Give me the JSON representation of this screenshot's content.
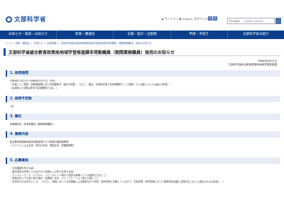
{
  "header": {
    "logo_text": "文部科学省",
    "sitemap": "▶ サイトマップ",
    "english": "▶ English",
    "font_size_label": "文字サイズの変更",
    "font_size_small": "小",
    "font_size_large": "大",
    "search_placeholder": "Custom Search",
    "search_logo": "Google"
  },
  "nav": [
    "お知らせ・報道・お知らせ",
    "政策・審議会",
    "白書・統計・出版物",
    "申請・手続き",
    "文部科学省の紹介"
  ],
  "breadcrumb": [
    "トップ",
    "政策・審議会",
    "お知らせ",
    "採用情報",
    "文部科学省総合教育政策局地域学習推進課非常勤職員（期間業務職員）採用のお知らせ"
  ],
  "title": "文部科学省総合教育政策局地域学習推進課非常勤職員（期間業務職員）採用のお知らせ",
  "date": "令和6年6月25日",
  "org": "文部科学省総合教育政策局地域学習推進課",
  "sections": [
    {
      "heading": "1. 採用期間",
      "lines": [
        "令和6年11月1日〜令和6年3月31日（予定）",
        "（年度ごとに契約。勤務実績等に応じ任用更新可（最大3年間）。ただし、国は、文部科学省で非常勤職員として勤務している者については最大3年間。）",
        "（採用後1ヵ月間は条件付採用期間となる。）"
      ]
    },
    {
      "heading": "2. 採用予定数",
      "lines": [
        "1名"
      ]
    },
    {
      "heading": "3. 職名",
      "lines": [
        "事務補佐員（非常勤職員（期間業務職員））"
      ]
    },
    {
      "heading": "4. 業務内容",
      "lines": [
        "総合教育政策局地域学習推進課で行う事務の補助業務等",
        "（パソコンによる文書・資料の作成、電話応対、書類整理等）"
      ]
    },
    {
      "heading": "5. 応募資格",
      "lines": [
        "・日本国籍を有する者",
        "・基本学校を卒業した又はそれと同等以上の学力を有する者",
        "・パソコン（ワード・エクセル、パワーポイント等の一般的な事務ソフトが使用できること）",
        "・素直を持って仕事に取り組み、協調性に富み、コミュニケーション能力が高いこと",
        "・在学中の方は不可とした。（ただし、夜間において大学講義による教育を行う学校・研究科等に在籍している方で、先録学業・研究科等において教育研究活動に支障が生じないと認められる方は除く。）"
      ]
    }
  ]
}
